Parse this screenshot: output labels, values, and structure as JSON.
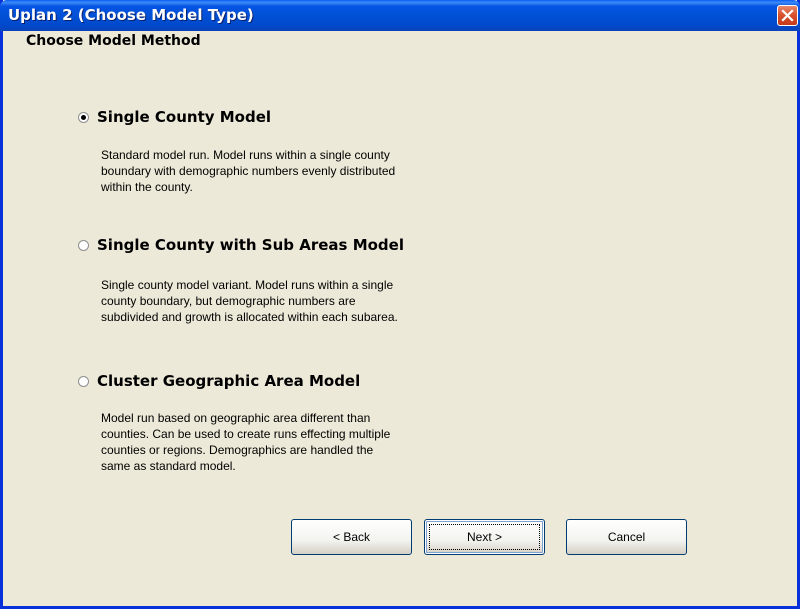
{
  "window": {
    "title": "Uplan 2 (Choose Model Type)",
    "close_icon": "close-icon"
  },
  "heading": "Choose Model Method",
  "options": [
    {
      "label": "Single County Model",
      "selected": true,
      "description": [
        "Standard model run. Model runs within a single county",
        "boundary with demographic numbers evenly distributed",
        "within the county."
      ]
    },
    {
      "label": "Single County with Sub Areas Model",
      "selected": false,
      "description": [
        "Single county model variant. Model runs within a single",
        "county boundary, but demographic numbers are",
        "subdivided and growth is allocated within each subarea."
      ]
    },
    {
      "label": "Cluster Geographic Area Model",
      "selected": false,
      "description": [
        "Model run based on geographic area different than",
        "counties. Can be used to create runs effecting multiple",
        "counties or regions. Demographics are handled the",
        "same as standard model."
      ]
    }
  ],
  "buttons": {
    "back": "< Back",
    "next": "Next >",
    "cancel": "Cancel"
  },
  "colors": {
    "titlebar": "#0151d6",
    "window_bg": "#ece9d8",
    "close_button": "#d9532f"
  }
}
